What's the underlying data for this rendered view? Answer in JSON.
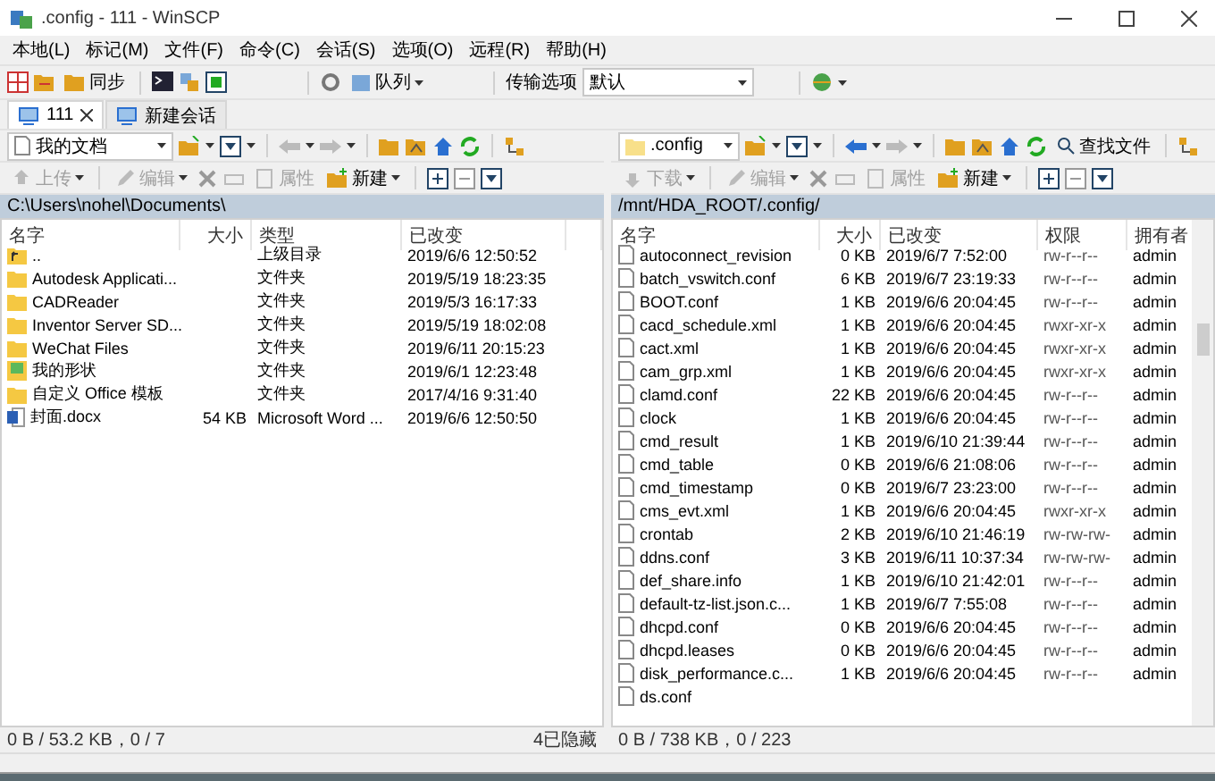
{
  "window": {
    "title": ".config - 111 - WinSCP"
  },
  "menu": [
    "本地(L)",
    "标记(M)",
    "文件(F)",
    "命令(C)",
    "会话(S)",
    "选项(O)",
    "远程(R)",
    "帮助(H)"
  ],
  "toolbar": {
    "sync": "同步",
    "queue": "队列",
    "transfer_label": "传输选项",
    "transfer_value": "默认"
  },
  "tabs": [
    {
      "label": "111",
      "selected": true,
      "kind": "session"
    },
    {
      "label": "新建会话",
      "selected": false,
      "kind": "new"
    }
  ],
  "left_pane": {
    "location": "我的文档",
    "actions": [
      {
        "label": "上传",
        "kind": "upload",
        "disabled": true
      },
      {
        "label": "编辑",
        "kind": "edit",
        "disabled": true
      },
      {
        "label": "属性",
        "kind": "properties",
        "disabled": true
      },
      {
        "label": "新建",
        "kind": "new",
        "disabled": false
      }
    ],
    "path": "C:\\Users\\nohel\\Documents\\",
    "columns": [
      "名字",
      "大小",
      "类型",
      "已改变"
    ],
    "rows": [
      {
        "kind": "parent",
        "cells": [
          "..",
          "",
          "上级目录",
          "2019/6/6  12:50:52"
        ]
      },
      {
        "kind": "folder",
        "cells": [
          "Autodesk Applicati...",
          "",
          "文件夹",
          "2019/5/19  18:23:35"
        ]
      },
      {
        "kind": "folder",
        "cells": [
          "CADReader",
          "",
          "文件夹",
          "2019/5/3  16:17:33"
        ]
      },
      {
        "kind": "folder",
        "cells": [
          "Inventor Server SD...",
          "",
          "文件夹",
          "2019/5/19  18:02:08"
        ]
      },
      {
        "kind": "folder",
        "cells": [
          "WeChat Files",
          "",
          "文件夹",
          "2019/6/11  20:15:23"
        ]
      },
      {
        "kind": "special",
        "cells": [
          "我的形状",
          "",
          "文件夹",
          "2019/6/1  12:23:48"
        ]
      },
      {
        "kind": "folder",
        "cells": [
          "自定义 Office 模板",
          "",
          "文件夹",
          "2017/4/16  9:31:40"
        ]
      },
      {
        "kind": "doc",
        "cells": [
          "封面.docx",
          "54 KB",
          "Microsoft Word ...",
          "2019/6/6  12:50:50"
        ]
      }
    ],
    "status": "0 B / 53.2 KB，0 / 7",
    "hidden": "4已隐藏"
  },
  "right_pane": {
    "location": ".config",
    "find": "查找文件",
    "actions": [
      {
        "label": "下载",
        "kind": "download",
        "disabled": true
      },
      {
        "label": "编辑",
        "kind": "edit",
        "disabled": true
      },
      {
        "label": "属性",
        "kind": "properties",
        "disabled": true
      },
      {
        "label": "新建",
        "kind": "new",
        "disabled": false
      }
    ],
    "path": "/mnt/HDA_ROOT/.config/",
    "columns": [
      "名字",
      "大小",
      "已改变",
      "权限",
      "拥有者"
    ],
    "rows": [
      [
        "autoconnect_revision",
        "0 KB",
        "2019/6/7 7:52:00",
        "rw-r--r--",
        "admin"
      ],
      [
        "batch_vswitch.conf",
        "6 KB",
        "2019/6/7 23:19:33",
        "rw-r--r--",
        "admin"
      ],
      [
        "BOOT.conf",
        "1 KB",
        "2019/6/6 20:04:45",
        "rw-r--r--",
        "admin"
      ],
      [
        "cacd_schedule.xml",
        "1 KB",
        "2019/6/6 20:04:45",
        "rwxr-xr-x",
        "admin"
      ],
      [
        "cact.xml",
        "1 KB",
        "2019/6/6 20:04:45",
        "rwxr-xr-x",
        "admin"
      ],
      [
        "cam_grp.xml",
        "1 KB",
        "2019/6/6 20:04:45",
        "rwxr-xr-x",
        "admin"
      ],
      [
        "clamd.conf",
        "22 KB",
        "2019/6/6 20:04:45",
        "rw-r--r--",
        "admin"
      ],
      [
        "clock",
        "1 KB",
        "2019/6/6 20:04:45",
        "rw-r--r--",
        "admin"
      ],
      [
        "cmd_result",
        "1 KB",
        "2019/6/10 21:39:44",
        "rw-r--r--",
        "admin"
      ],
      [
        "cmd_table",
        "0 KB",
        "2019/6/6 21:08:06",
        "rw-r--r--",
        "admin"
      ],
      [
        "cmd_timestamp",
        "0 KB",
        "2019/6/7 23:23:00",
        "rw-r--r--",
        "admin"
      ],
      [
        "cms_evt.xml",
        "1 KB",
        "2019/6/6 20:04:45",
        "rwxr-xr-x",
        "admin"
      ],
      [
        "crontab",
        "2 KB",
        "2019/6/10 21:46:19",
        "rw-rw-rw-",
        "admin"
      ],
      [
        "ddns.conf",
        "3 KB",
        "2019/6/11 10:37:34",
        "rw-rw-rw-",
        "admin"
      ],
      [
        "def_share.info",
        "1 KB",
        "2019/6/10 21:42:01",
        "rw-r--r--",
        "admin"
      ],
      [
        "default-tz-list.json.c...",
        "1 KB",
        "2019/6/7 7:55:08",
        "rw-r--r--",
        "admin"
      ],
      [
        "dhcpd.conf",
        "0 KB",
        "2019/6/6 20:04:45",
        "rw-r--r--",
        "admin"
      ],
      [
        "dhcpd.leases",
        "0 KB",
        "2019/6/6 20:04:45",
        "rw-r--r--",
        "admin"
      ],
      [
        "disk_performance.c...",
        "1 KB",
        "2019/6/6 20:04:45",
        "rw-r--r--",
        "admin"
      ],
      [
        "ds.conf",
        "",
        "",
        "",
        ""
      ]
    ],
    "status": "0 B / 738 KB，0 / 223"
  }
}
